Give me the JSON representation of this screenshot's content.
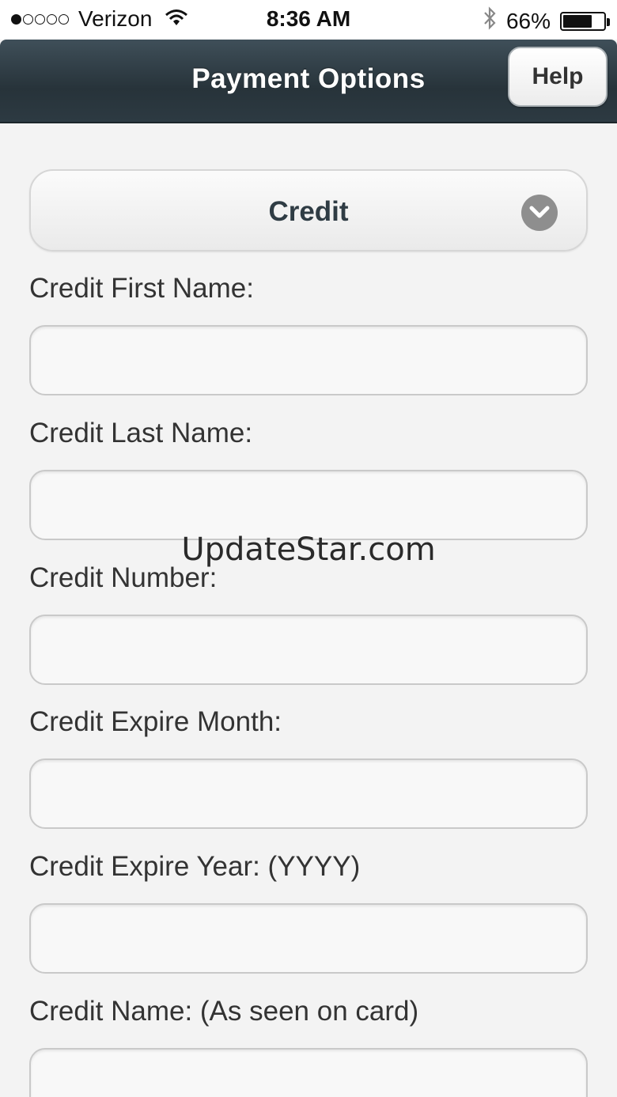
{
  "status_bar": {
    "carrier": "Verizon",
    "time": "8:36 AM",
    "battery": "66%",
    "signal_bars_filled": 1,
    "signal_bars_total": 5
  },
  "header": {
    "title": "Payment Options",
    "help_label": "Help"
  },
  "payment_type": {
    "selected": "Credit"
  },
  "form": {
    "fields": [
      {
        "label": "Credit First Name:",
        "value": ""
      },
      {
        "label": "Credit Last Name:",
        "value": ""
      },
      {
        "label": "Credit Number:",
        "value": ""
      },
      {
        "label": "Credit Expire Month:",
        "value": ""
      },
      {
        "label": "Credit Expire Year: (YYYY)",
        "value": ""
      },
      {
        "label": "Credit Name: (As seen on card)",
        "value": ""
      }
    ]
  },
  "watermark": "UpdateStar.com",
  "colors": {
    "header_bg": "#2d3a42",
    "page_bg": "#f3f3f3"
  },
  "icons": {
    "wifi": "wifi-icon",
    "bluetooth": "bluetooth-icon",
    "battery": "battery-icon",
    "select_chevron": "chevron-down-icon"
  }
}
